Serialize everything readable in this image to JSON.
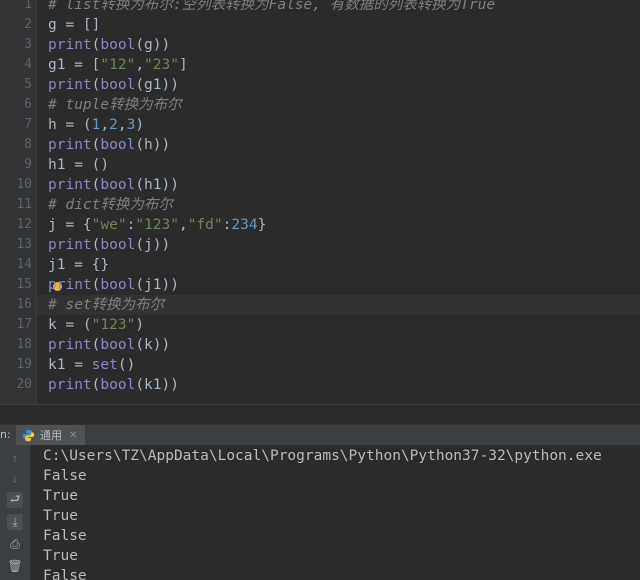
{
  "editor": {
    "lines": [
      {
        "n": "1",
        "segs": [
          {
            "t": "# list转换为布尔:空列表转换为False, 有数据的列表转换为True",
            "c": "cmt"
          }
        ]
      },
      {
        "n": "2",
        "segs": [
          {
            "t": "g = []",
            "c": ""
          }
        ]
      },
      {
        "n": "3",
        "segs": [
          {
            "t": "print",
            "c": "bi"
          },
          {
            "t": "(",
            "c": ""
          },
          {
            "t": "bool",
            "c": "bi"
          },
          {
            "t": "(g))",
            "c": ""
          }
        ]
      },
      {
        "n": "4",
        "segs": [
          {
            "t": "g1 = [",
            "c": ""
          },
          {
            "t": "\"12\"",
            "c": "str"
          },
          {
            "t": ",",
            "c": ""
          },
          {
            "t": "\"23\"",
            "c": "str"
          },
          {
            "t": "]",
            "c": ""
          }
        ]
      },
      {
        "n": "5",
        "segs": [
          {
            "t": "print",
            "c": "bi"
          },
          {
            "t": "(",
            "c": ""
          },
          {
            "t": "bool",
            "c": "bi"
          },
          {
            "t": "(g1))",
            "c": ""
          }
        ]
      },
      {
        "n": "6",
        "segs": [
          {
            "t": "# tuple转换为布尔",
            "c": "cmt"
          }
        ]
      },
      {
        "n": "7",
        "segs": [
          {
            "t": "h = (",
            "c": ""
          },
          {
            "t": "1",
            "c": "num"
          },
          {
            "t": ",",
            "c": ""
          },
          {
            "t": "2",
            "c": "num"
          },
          {
            "t": ",",
            "c": ""
          },
          {
            "t": "3",
            "c": "num"
          },
          {
            "t": ")",
            "c": ""
          }
        ]
      },
      {
        "n": "8",
        "segs": [
          {
            "t": "print",
            "c": "bi"
          },
          {
            "t": "(",
            "c": ""
          },
          {
            "t": "bool",
            "c": "bi"
          },
          {
            "t": "(h))",
            "c": ""
          }
        ]
      },
      {
        "n": "9",
        "segs": [
          {
            "t": "h1 = ()",
            "c": ""
          }
        ]
      },
      {
        "n": "10",
        "segs": [
          {
            "t": "print",
            "c": "bi"
          },
          {
            "t": "(",
            "c": ""
          },
          {
            "t": "bool",
            "c": "bi"
          },
          {
            "t": "(h1))",
            "c": ""
          }
        ]
      },
      {
        "n": "11",
        "segs": [
          {
            "t": "# dict转换为布尔",
            "c": "cmt"
          }
        ]
      },
      {
        "n": "12",
        "segs": [
          {
            "t": "j = {",
            "c": ""
          },
          {
            "t": "\"we\"",
            "c": "str"
          },
          {
            "t": ":",
            "c": ""
          },
          {
            "t": "\"123\"",
            "c": "str"
          },
          {
            "t": ",",
            "c": ""
          },
          {
            "t": "\"fd\"",
            "c": "str"
          },
          {
            "t": ":",
            "c": ""
          },
          {
            "t": "234",
            "c": "num"
          },
          {
            "t": "}",
            "c": ""
          }
        ]
      },
      {
        "n": "13",
        "segs": [
          {
            "t": "print",
            "c": "bi"
          },
          {
            "t": "(",
            "c": ""
          },
          {
            "t": "bool",
            "c": "bi"
          },
          {
            "t": "(j))",
            "c": ""
          }
        ]
      },
      {
        "n": "14",
        "segs": [
          {
            "t": "j1 = {}",
            "c": ""
          }
        ]
      },
      {
        "n": "15",
        "segs": [
          {
            "t": "print",
            "c": "bi"
          },
          {
            "t": "(",
            "c": ""
          },
          {
            "t": "bool",
            "c": "bi"
          },
          {
            "t": "(j1))",
            "c": ""
          }
        ]
      },
      {
        "n": "16",
        "segs": [
          {
            "t": "# set转换为布尔",
            "c": "cmt"
          }
        ],
        "current": true
      },
      {
        "n": "17",
        "segs": [
          {
            "t": "k = (",
            "c": ""
          },
          {
            "t": "\"123\"",
            "c": "str"
          },
          {
            "t": ")",
            "c": ""
          }
        ]
      },
      {
        "n": "18",
        "segs": [
          {
            "t": "print",
            "c": "bi"
          },
          {
            "t": "(",
            "c": ""
          },
          {
            "t": "bool",
            "c": "bi"
          },
          {
            "t": "(k))",
            "c": ""
          }
        ]
      },
      {
        "n": "19",
        "segs": [
          {
            "t": "k1 = ",
            "c": ""
          },
          {
            "t": "set",
            "c": "bi"
          },
          {
            "t": "()",
            "c": ""
          }
        ]
      },
      {
        "n": "20",
        "segs": [
          {
            "t": "print",
            "c": "bi"
          },
          {
            "t": "(",
            "c": ""
          },
          {
            "t": "bool",
            "c": "bi"
          },
          {
            "t": "(k1))",
            "c": ""
          }
        ]
      }
    ]
  },
  "run_panel": {
    "label": "n:",
    "tab_title": "通用",
    "tab_icon": "python-icon",
    "toolbar": [
      {
        "name": "scroll-up-icon",
        "glyph": "↑",
        "state": "disabled"
      },
      {
        "name": "scroll-down-icon",
        "glyph": "↓",
        "state": "disabled"
      },
      {
        "name": "soft-wrap-icon",
        "glyph": "⮐",
        "state": "active"
      },
      {
        "name": "scroll-to-end-icon",
        "glyph": "⤓",
        "state": "active"
      },
      {
        "name": "print-icon",
        "glyph": "⎙",
        "state": ""
      },
      {
        "name": "delete-icon",
        "glyph": "🗑",
        "state": ""
      }
    ],
    "output": [
      "C:\\Users\\TZ\\AppData\\Local\\Programs\\Python\\Python37-32\\python.exe",
      "False",
      "True",
      "True",
      "False",
      "True",
      "False"
    ]
  },
  "colors": {
    "background": "#2b2b2b",
    "comment": "#808080",
    "builtin": "#8888c6",
    "string": "#6a8759",
    "number": "#6897bb",
    "text": "#a9b7c6"
  }
}
